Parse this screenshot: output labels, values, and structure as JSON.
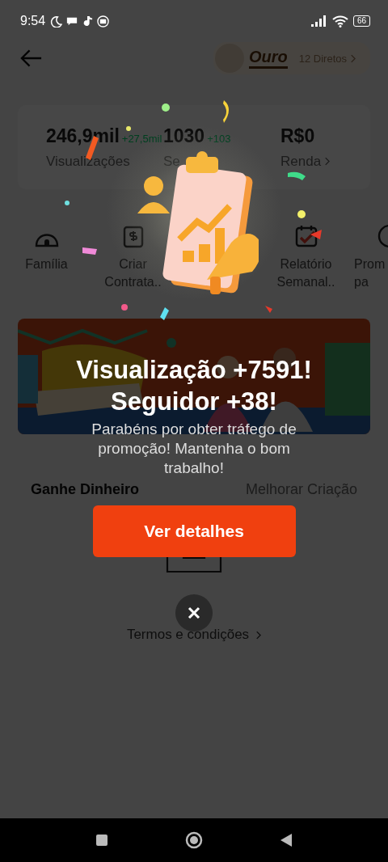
{
  "status_bar": {
    "time": "9:54",
    "battery": "66"
  },
  "header": {
    "level": "Ouro",
    "directs": "12 Diretos"
  },
  "stats": [
    {
      "value": "246,9mil",
      "delta": "+27,5mil",
      "label": "Visualizações"
    },
    {
      "value": "1030",
      "delta": "+103",
      "label": "Se"
    },
    {
      "value": "R$0",
      "label": "Renda",
      "link": true
    }
  ],
  "shortcuts": [
    {
      "kind": "family",
      "label": "Família"
    },
    {
      "kind": "contract",
      "label": "Criar Contrata.."
    },
    {
      "kind": "report",
      "label": "Relatório Semanal.."
    },
    {
      "kind": "promo",
      "label": "Prom pa"
    }
  ],
  "tabs": [
    {
      "label": "Ganhe Dinheiro",
      "selected": true
    },
    {
      "label": "Melhorar Criação",
      "selected": false
    }
  ],
  "empty_state": {
    "link": "Termos e condições"
  },
  "modal": {
    "title_lines": [
      "Visualização +7591!",
      "Seguidor +38!"
    ],
    "message": "Parabéns por obter tráfego de promoção! Mantenha o bom trabalho!",
    "button": "Ver detalhes"
  }
}
